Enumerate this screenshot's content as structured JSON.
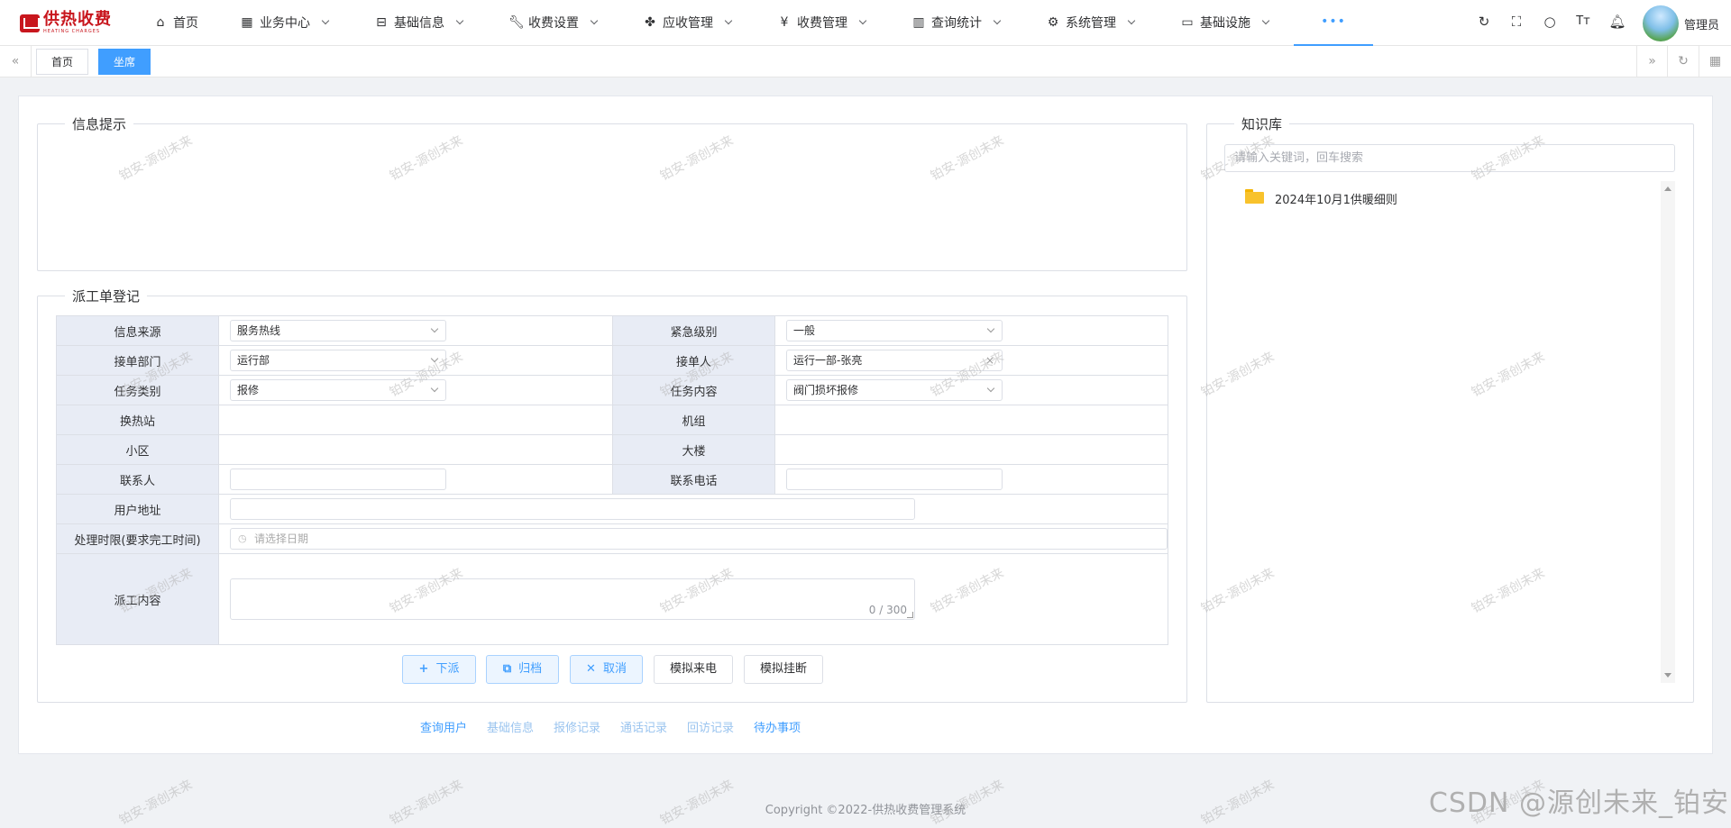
{
  "app": {
    "logo_text": "供热收费",
    "logo_sub": "HEATING CHARGES",
    "user_name": "管理员"
  },
  "nav": [
    {
      "label": "首页",
      "icon": "home-icon"
    },
    {
      "label": "业务中心",
      "icon": "grid-icon"
    },
    {
      "label": "基础信息",
      "icon": "inbox-icon"
    },
    {
      "label": "收费设置",
      "icon": "wrench-icon"
    },
    {
      "label": "应收管理",
      "icon": "leaf-icon"
    },
    {
      "label": "收费管理",
      "icon": "yen-icon"
    },
    {
      "label": "查询统计",
      "icon": "bar-chart-icon"
    },
    {
      "label": "系统管理",
      "icon": "gear-icon"
    },
    {
      "label": "基础设施",
      "icon": "monitor-icon"
    }
  ],
  "nav_more": "•••",
  "tags": [
    "首页",
    "坐席"
  ],
  "info_box": {
    "title": "信息提示"
  },
  "dispatch": {
    "title": "派工单登记",
    "source_label": "信息来源",
    "source_value": "服务热线",
    "urgency_label": "紧急级别",
    "urgency_value": "一般",
    "dept_label": "接单部门",
    "dept_value": "运行部",
    "receiver_label": "接单人",
    "receiver_value": "运行一部-张亮",
    "task_type_label": "任务类别",
    "task_type_value": "报修",
    "task_content_label": "任务内容",
    "task_content_value": "阀门损坏报修",
    "station_label": "换热站",
    "unit_label": "机组",
    "community_label": "小区",
    "building_label": "大楼",
    "contact_label": "联系人",
    "phone_label": "联系电话",
    "address_label": "用户地址",
    "deadline_label": "处理时限(要求完工时间)",
    "deadline_placeholder": "请选择日期",
    "content_label": "派工内容",
    "content_counter": "0 / 300"
  },
  "buttons": {
    "dispatch": "下派",
    "archive": "归档",
    "cancel": "取消",
    "sim_call": "模拟来电",
    "sim_hangup": "模拟挂断"
  },
  "links": [
    "查询用户",
    "基础信息",
    "报修记录",
    "通话记录",
    "回访记录",
    "待办事项"
  ],
  "knowledge": {
    "title": "知识库",
    "search_placeholder": "请输入关键词，回车搜索",
    "items": [
      "2024年10月1供暖细则"
    ]
  },
  "footer": {
    "copyright": "Copyright ©2022-供热收费管理系统"
  },
  "watermark_text": "铂安-源创未来",
  "csdn_watermark": "CSDN @源创未来_铂安",
  "colors": {
    "accent": "#409eff",
    "brand": "#c8161d",
    "label_bg": "#e8ecf5"
  }
}
